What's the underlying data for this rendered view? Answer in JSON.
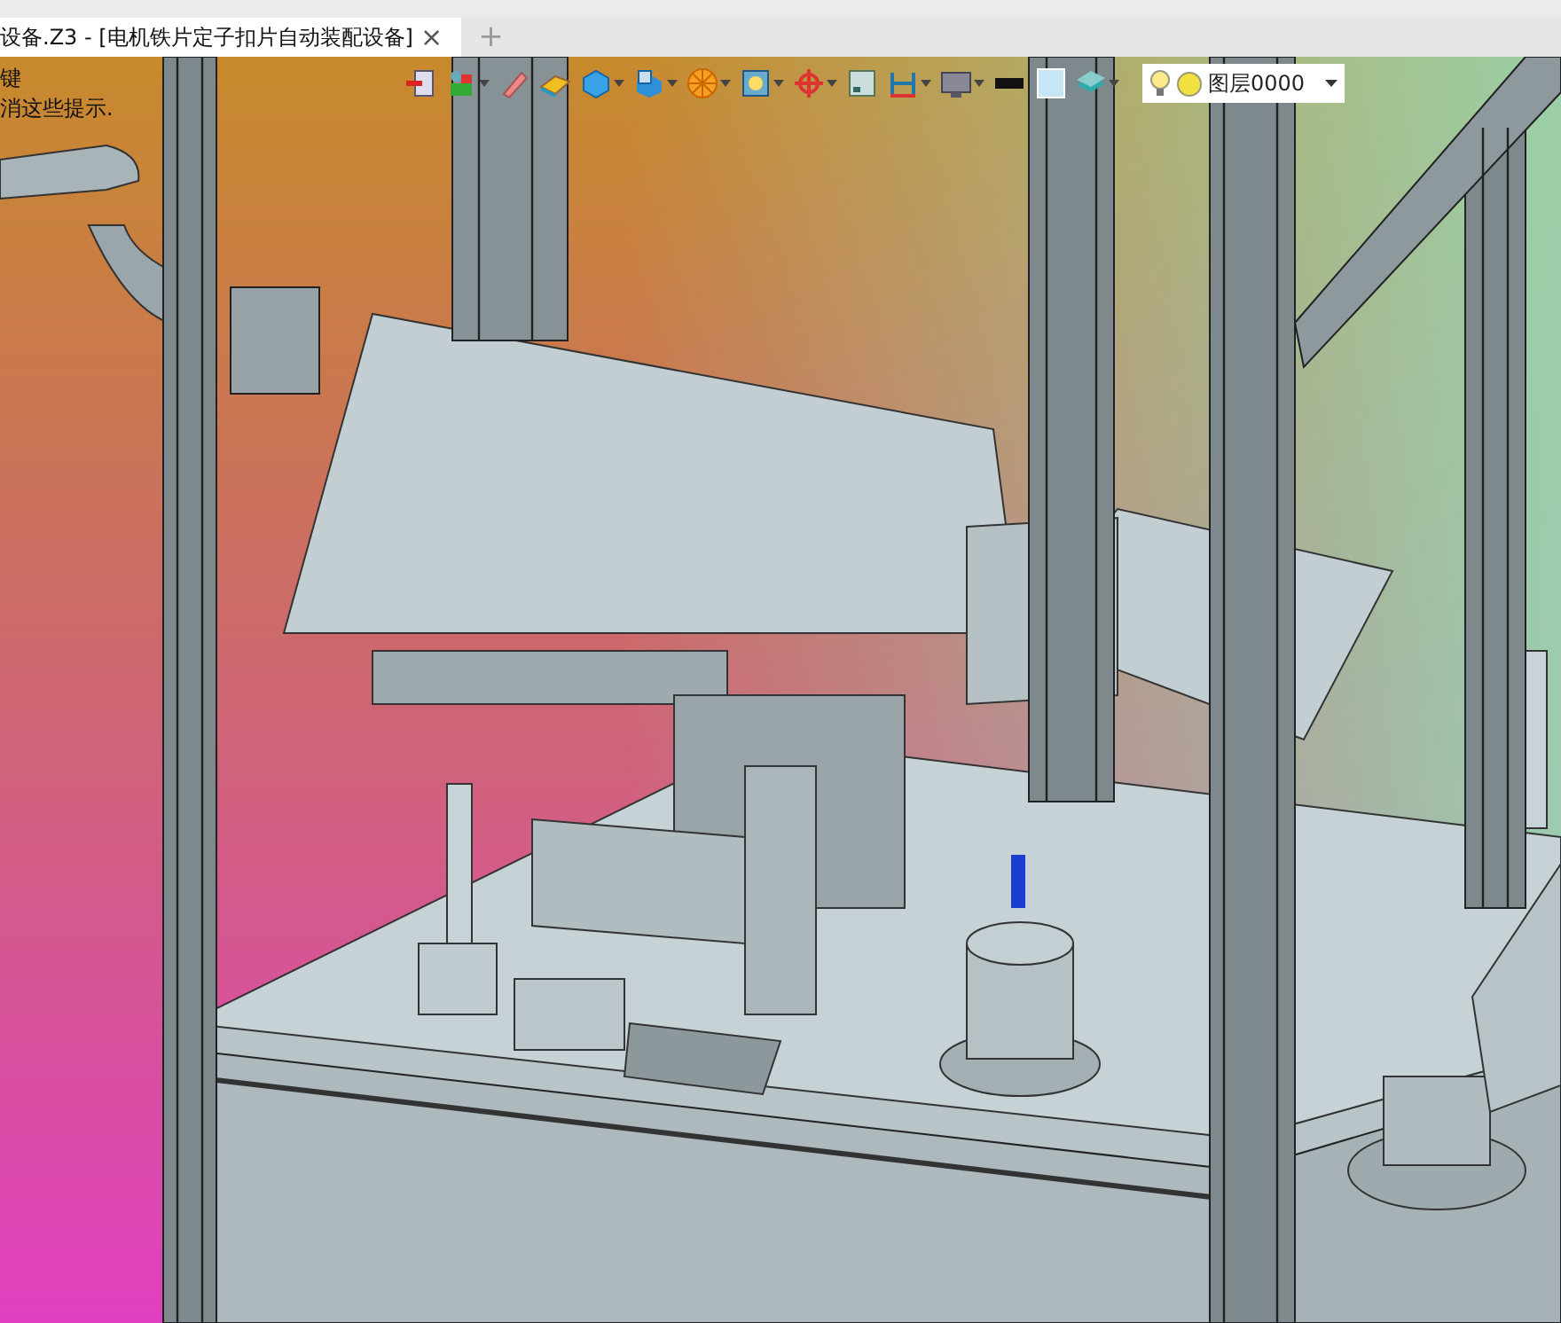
{
  "tabs": [
    {
      "title": "设备.Z3 - [电机铁片定子扣片自动装配设备]",
      "selected": true,
      "close": "×"
    }
  ],
  "new_tab": "+",
  "hints": [
    "键",
    "消这些提示."
  ],
  "toolbar": [
    {
      "kind": "exit",
      "dropdown": false
    },
    {
      "kind": "filter",
      "dropdown": true
    },
    {
      "kind": "pencil",
      "dropdown": false
    },
    {
      "kind": "plane",
      "dropdown": false
    },
    {
      "kind": "cube",
      "dropdown": true
    },
    {
      "kind": "view",
      "dropdown": true
    },
    {
      "kind": "wheel",
      "dropdown": true
    },
    {
      "kind": "zoom",
      "dropdown": true
    },
    {
      "kind": "target",
      "dropdown": true
    },
    {
      "kind": "frame",
      "dropdown": false
    },
    {
      "kind": "dimension",
      "dropdown": true
    },
    {
      "kind": "display",
      "dropdown": true
    },
    {
      "kind": "swatch-dark",
      "dropdown": false
    },
    {
      "kind": "swatch-light",
      "dropdown": false
    },
    {
      "kind": "layers",
      "dropdown": true
    }
  ],
  "layer_combo": {
    "value": "图层0000"
  }
}
